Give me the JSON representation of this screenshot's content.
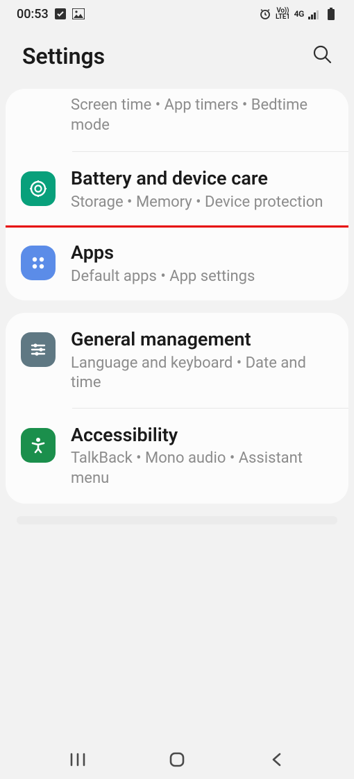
{
  "status": {
    "time": "00:53",
    "network": "4G",
    "lte": "LTE1",
    "vo": "Vo))"
  },
  "header": {
    "title": "Settings"
  },
  "card1": {
    "rows": [
      {
        "title": "",
        "subtitle": "Screen time  •  App timers  •  Bedtime mode"
      },
      {
        "title": "Battery and device care",
        "subtitle": "Storage  •  Memory  •  Device protection"
      },
      {
        "title": "Apps",
        "subtitle": "Default apps  •  App settings"
      }
    ]
  },
  "card2": {
    "rows": [
      {
        "title": "General management",
        "subtitle": "Language and keyboard  •  Date and time"
      },
      {
        "title": "Accessibility",
        "subtitle": "TalkBack  •  Mono audio  •  Assistant menu"
      }
    ]
  }
}
